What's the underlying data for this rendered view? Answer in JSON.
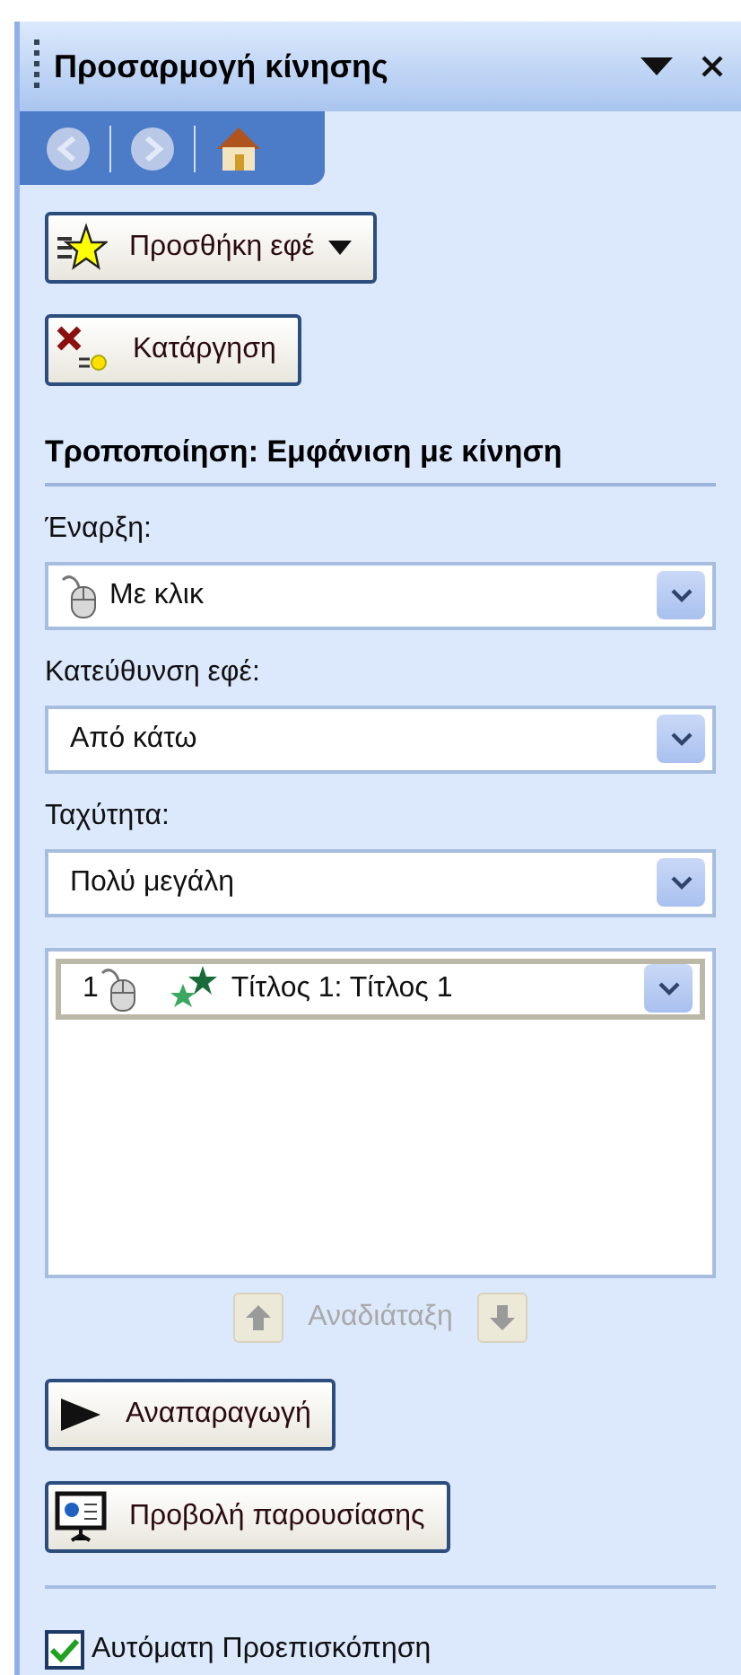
{
  "pane": {
    "title": "Προσαρμογή κίνησης"
  },
  "add_effect_button": "Προσθήκη εφέ",
  "remove_button": "Κατάργηση",
  "section_heading": "Τροποποίηση: Εμφάνιση με κίνηση",
  "fields": [
    {
      "label": "Έναρξη:",
      "value": "Με κλικ",
      "kind": "mouse"
    },
    {
      "label": "Κατεύθυνση εφέ:",
      "value": "Από κάτω",
      "kind": "plain"
    },
    {
      "label": "Ταχύτητα:",
      "value": "Πολύ μεγάλη",
      "kind": "plain"
    }
  ],
  "effects_list": [
    {
      "number": "1",
      "name": "Τίτλος 1: Τίτλος 1",
      "selected": true
    }
  ],
  "reorder": {
    "label": "Αναδιάταξη",
    "disabled": true
  },
  "play_button": "Αναπαραγωγή",
  "slideshow_button": "Προβολή παρουσίασης",
  "autopreview": {
    "label": "Αυτόματη Προεπισκόπηση",
    "checked": true
  }
}
